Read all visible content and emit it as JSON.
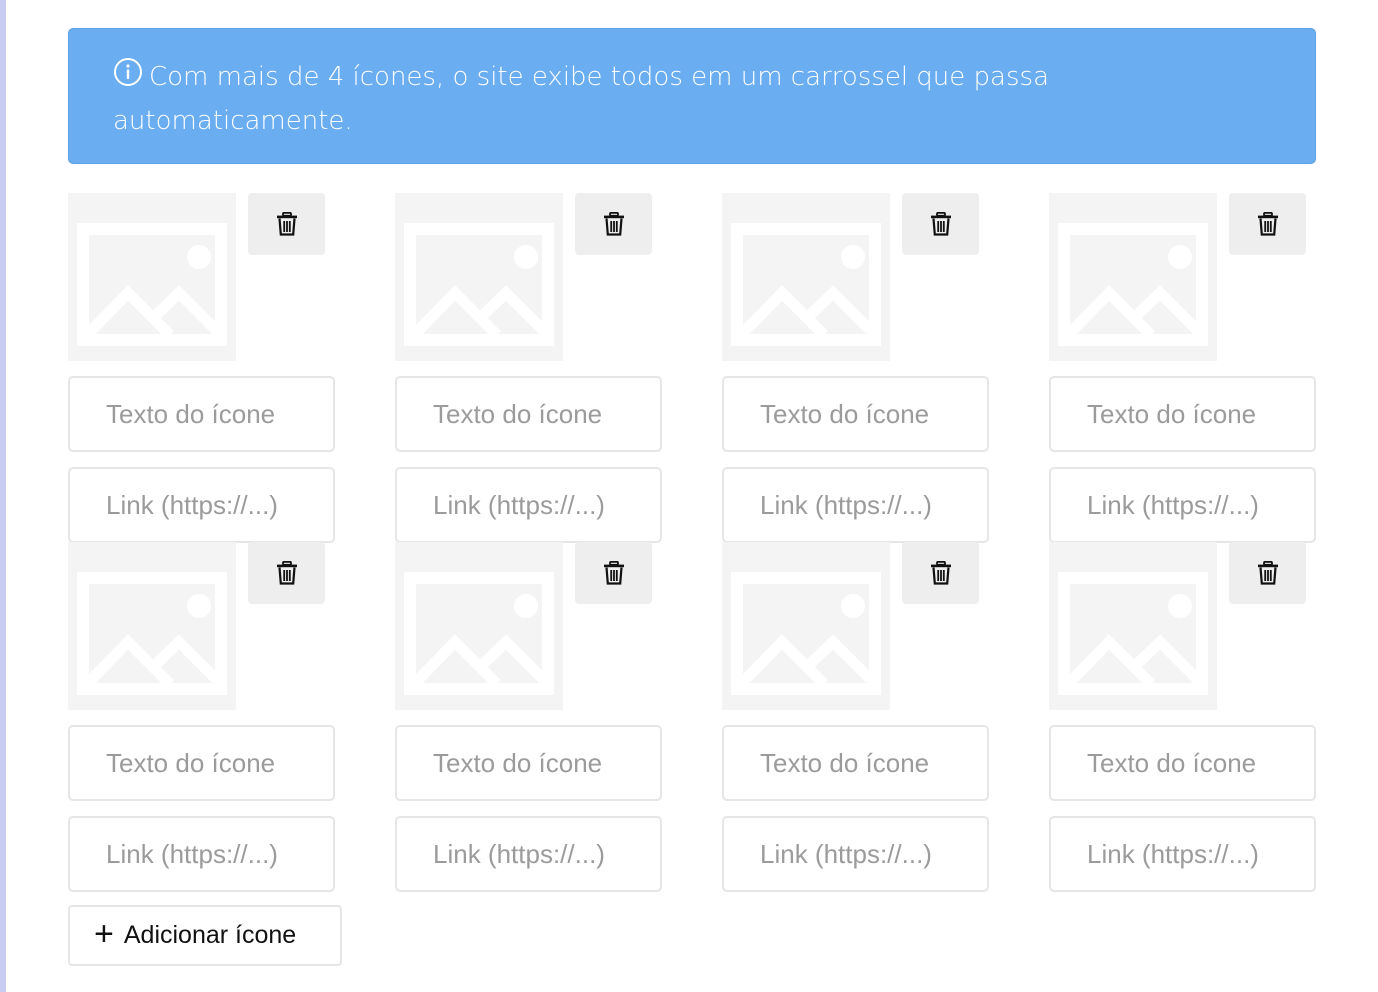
{
  "banner": {
    "icon": "info-circle-icon",
    "text": "Com mais de 4 ícones, o site exibe todos em um carrossel que passa automaticamente."
  },
  "placeholders": {
    "text": "Texto do ícone",
    "link": "Link (https://...)"
  },
  "items": [
    {
      "text": "",
      "link": ""
    },
    {
      "text": "",
      "link": ""
    },
    {
      "text": "",
      "link": ""
    },
    {
      "text": "",
      "link": ""
    },
    {
      "text": "",
      "link": ""
    },
    {
      "text": "",
      "link": ""
    },
    {
      "text": "",
      "link": ""
    },
    {
      "text": "",
      "link": ""
    }
  ],
  "add_button": {
    "icon": "plus-icon",
    "label": "Adicionar ícone"
  },
  "colors": {
    "banner_bg": "#6aadf1",
    "left_rail": "#c9cdf3"
  }
}
